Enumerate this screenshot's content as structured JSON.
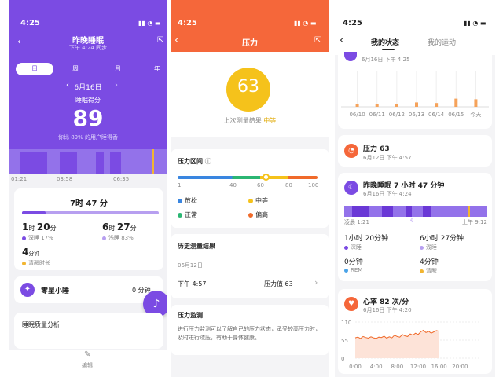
{
  "sleep_screen": {
    "time": "4:25",
    "title": "昨晚睡眠",
    "subtitle": "下午 4:24 同步",
    "tabs": [
      "日",
      "周",
      "月",
      "年"
    ],
    "date": "6月16日",
    "score_label": "睡眠得分",
    "score": "89",
    "percentile": "你比 89% 的用户睡得香",
    "timeline_ticks": [
      "01:21",
      "03:58",
      "06:35"
    ],
    "total_duration": "7时 47 分",
    "deep_value": "1",
    "deep_unit1": "时",
    "deep_min": "20",
    "deep_unit2": "分",
    "deep_label": "深睡 17%",
    "light_value": "6",
    "light_unit1": "时",
    "light_min": "27",
    "light_unit2": "分",
    "light_label": "浅睡 83%",
    "awake_value": "4",
    "awake_unit": "分钟",
    "awake_label": "清醒时长",
    "nap_label": "零星小睡",
    "nap_value": "0 分钟",
    "analysis_label": "睡眠质量分析",
    "edit_label": "编辑",
    "colors": {
      "header": "#7b4be3",
      "deep": "#7b4be3",
      "light": "#b79ff0",
      "awake": "#f2b531"
    }
  },
  "stress_screen": {
    "time": "4:25",
    "title": "压力",
    "score": "63",
    "last_result_label": "上次测量结果",
    "last_result_level": "中等",
    "range_title": "压力区间",
    "scale_ticks": [
      "1",
      "40",
      "60",
      "80",
      "100"
    ],
    "legend": [
      {
        "label": "放松",
        "color": "#3a86e0"
      },
      {
        "label": "中等",
        "color": "#f5c21b"
      },
      {
        "label": "正常",
        "color": "#2bb673"
      },
      {
        "label": "偏高",
        "color": "#f06a2a"
      }
    ],
    "history_title": "历史测量结果",
    "history_date": "06月12日",
    "history_time": "下午 4:57",
    "history_value": "压力值 63",
    "monitor_title": "压力监测",
    "monitor_desc": "进行压力监测可以了解自己的压力状态，承受较高压力时，及时进行疏压，有助于身体健康。",
    "colors": {
      "header": "#f5673a",
      "badge": "#f5c21b"
    }
  },
  "status_screen": {
    "time": "4:25",
    "tab_active": "我的状态",
    "tab_inactive": "我的运动",
    "top_card_date": "6月16日 下午 4:25",
    "bar_chart_labels": [
      "06/10",
      "06/11",
      "06/12",
      "06/13",
      "06/14",
      "06/15",
      "今天"
    ],
    "stress_title": "压力 63",
    "stress_date": "6月12日 下午 4:57",
    "sleep_title": "昨晚睡眠 7 小时 47 分钟",
    "sleep_date": "6月16日 下午 4:24",
    "sleep_start": "凌晨 1:21",
    "sleep_end": "上午 9:12",
    "deep": "1小时 20分钟",
    "deep_label": "深睡",
    "light": "6小时 27分钟",
    "light_label": "浅睡",
    "rem": "0分钟",
    "rem_label": "REM",
    "awake": "4分钟",
    "awake_label": "清醒",
    "heart_title": "心率 82 次/分",
    "heart_date": "6月16日 下午 4:20",
    "hr_y_ticks": [
      "110",
      "55",
      "0"
    ],
    "hr_x_ticks": [
      "0:00",
      "4:00",
      "8:00",
      "12:00",
      "16:00",
      "20:00"
    ],
    "colors": {
      "sleep_bar": "#7b4be3",
      "stress_icon": "#f5673a",
      "heart_icon": "#f5673a",
      "bar": "#f5a25a"
    }
  },
  "chart_data": [
    {
      "type": "bar",
      "categories": [
        "06/10",
        "06/11",
        "06/12",
        "06/13",
        "06/14",
        "06/15",
        "今天"
      ],
      "values": [
        1,
        1,
        0.8,
        1.4,
        1.2,
        2.6,
        2.4
      ]
    },
    {
      "type": "line",
      "x_ticks": [
        "0:00",
        "4:00",
        "8:00",
        "12:00",
        "16:00",
        "20:00"
      ],
      "y_ticks": [
        110,
        55,
        0
      ],
      "x": [
        0,
        0.5,
        1,
        1.5,
        2,
        2.5,
        3,
        3.5,
        4,
        4.5,
        5,
        5.5,
        6,
        6.5,
        7,
        7.5,
        8,
        8.5,
        9,
        9.5,
        10,
        10.5,
        11,
        11.5,
        12,
        12.5,
        13,
        13.5,
        14,
        14.5,
        15,
        15.5,
        16
      ],
      "values": [
        62,
        64,
        60,
        66,
        63,
        61,
        65,
        62,
        60,
        64,
        63,
        67,
        61,
        65,
        62,
        70,
        66,
        64,
        72,
        68,
        66,
        74,
        70,
        76,
        72,
        80,
        85,
        78,
        82,
        76,
        80,
        84,
        82
      ]
    }
  ]
}
